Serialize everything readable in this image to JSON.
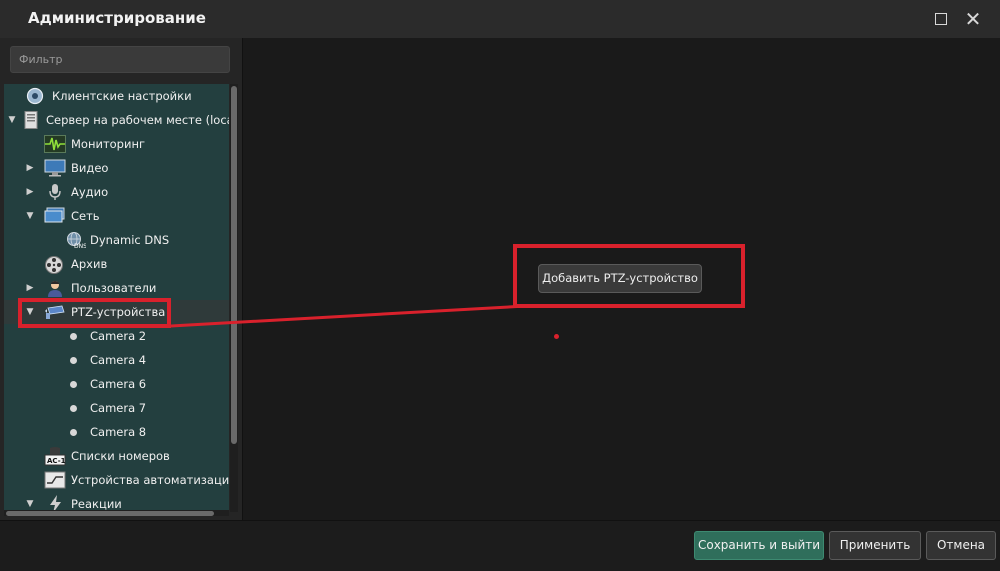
{
  "window": {
    "title": "Администрирование"
  },
  "sidebar": {
    "filter_placeholder": "Фильтр",
    "items": [
      {
        "label": "Клиентские настройки",
        "icon": "gear-icon"
      },
      {
        "label": "Сервер на рабочем месте (localhost",
        "icon": "server-icon",
        "expanded": true
      },
      {
        "label": "Мониторинг",
        "icon": "monitoring-icon"
      },
      {
        "label": "Видео",
        "icon": "monitor-icon",
        "expanded": false
      },
      {
        "label": "Аудио",
        "icon": "microphone-icon",
        "expanded": false
      },
      {
        "label": "Сеть",
        "icon": "network-icon",
        "expanded": true
      },
      {
        "label": "Dynamic DNS",
        "icon": "dns-globe-icon"
      },
      {
        "label": "Архив",
        "icon": "film-reel-icon"
      },
      {
        "label": "Пользователи",
        "icon": "user-icon",
        "expanded": false
      },
      {
        "label": "PTZ-устройства",
        "icon": "ptz-camera-icon",
        "expanded": true,
        "selected": true
      },
      {
        "label": "Camera 2"
      },
      {
        "label": "Camera 4"
      },
      {
        "label": "Camera 6"
      },
      {
        "label": "Camera 7"
      },
      {
        "label": "Camera 8"
      },
      {
        "label": "Списки номеров",
        "icon": "license-plate-icon"
      },
      {
        "label": "Устройства автоматизации",
        "icon": "automation-icon"
      },
      {
        "label": "Реакции",
        "icon": "lightning-icon",
        "expanded": true
      }
    ]
  },
  "main": {
    "add_ptz_button": "Добавить PTZ-устройство"
  },
  "footer": {
    "save_exit": "Сохранить и выйти",
    "apply": "Применить",
    "cancel": "Отмена"
  },
  "colors": {
    "accent_save": "#2f6e5b",
    "annotation_red": "#d9212c",
    "tree_bg": "#233f3f"
  }
}
